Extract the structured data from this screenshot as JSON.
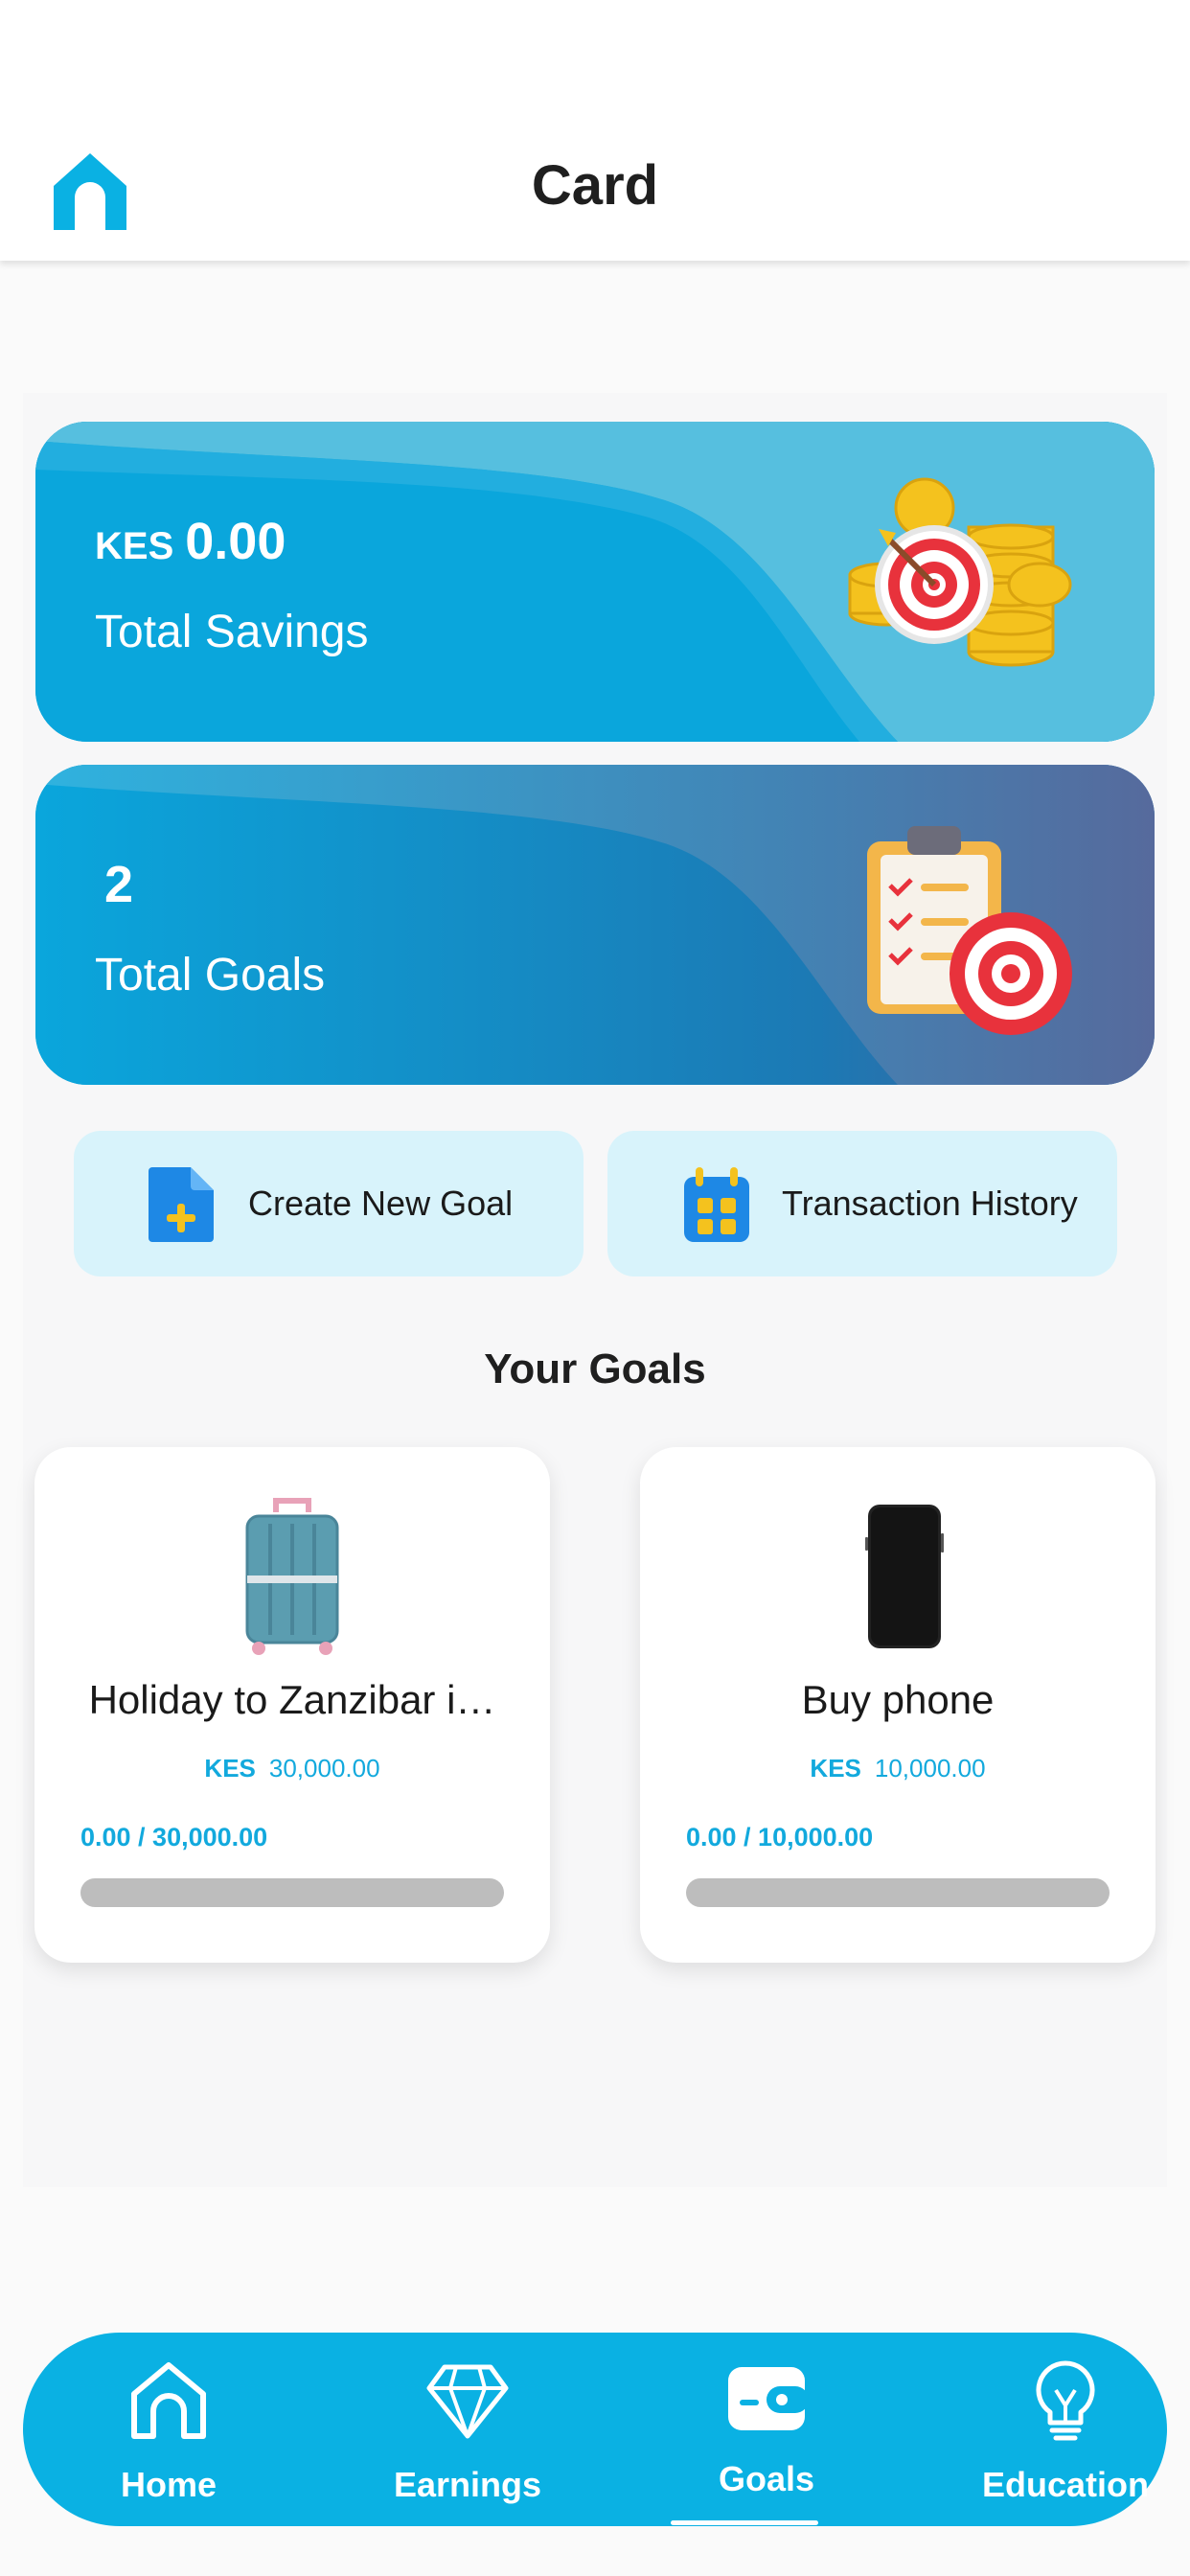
{
  "header": {
    "title": "Card",
    "home_icon": "home-icon"
  },
  "stats": {
    "savings": {
      "currency": "KES",
      "amount": "0.00",
      "label": "Total Savings",
      "icon": "target-coins-illustration"
    },
    "goals": {
      "count": "2",
      "label": "Total Goals",
      "icon": "clipboard-target-illustration"
    }
  },
  "actions": {
    "create_goal": {
      "label": "Create New Goal",
      "icon": "add-document-icon"
    },
    "transaction_history": {
      "label": "Transaction History",
      "icon": "calendar-icon"
    }
  },
  "goals_section": {
    "title": "Your Goals",
    "items": [
      {
        "name": "Holiday to Zanzibar i…",
        "currency": "KES",
        "target": "30,000.00",
        "progress_text": "0.00 / 30,000.00",
        "progress_fraction": 0,
        "image": "suitcase-image"
      },
      {
        "name": "Buy phone",
        "currency": "KES",
        "target": "10,000.00",
        "progress_text": "0.00 / 10,000.00",
        "progress_fraction": 0,
        "image": "phone-image"
      }
    ]
  },
  "nav": {
    "active": "Goals",
    "items": [
      {
        "label": "Home",
        "icon": "home-icon"
      },
      {
        "label": "Earnings",
        "icon": "diamond-icon"
      },
      {
        "label": "Goals",
        "icon": "wallet-icon"
      },
      {
        "label": "Education",
        "icon": "lightbulb-icon"
      }
    ]
  },
  "colors": {
    "accent": "#0ab1e3",
    "action_bg": "#d8f3fb",
    "progress_track": "#bdbdbd"
  }
}
